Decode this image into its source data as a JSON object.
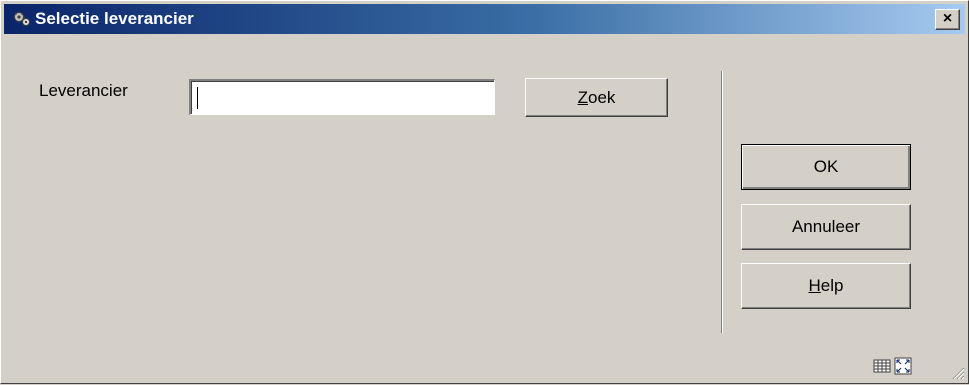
{
  "window": {
    "title": "Selectie leverancier",
    "close_label": "×"
  },
  "form": {
    "supplier_label": "Leverancier",
    "supplier_value": "",
    "search_button": {
      "mnemonic": "Z",
      "rest": "oek"
    }
  },
  "actions": {
    "ok_label": "OK",
    "cancel_label": "Annuleer",
    "help_button": {
      "mnemonic": "H",
      "rest": "elp"
    }
  },
  "icons": {
    "title": "app-gear-icon",
    "status_left": "keyboard-icon",
    "status_right": "maximize-icon",
    "grip": "resize-grip-icon"
  },
  "colors": {
    "titlebar_start": "#0a246a",
    "titlebar_end": "#a6caf0",
    "face": "#d4d0c8"
  }
}
